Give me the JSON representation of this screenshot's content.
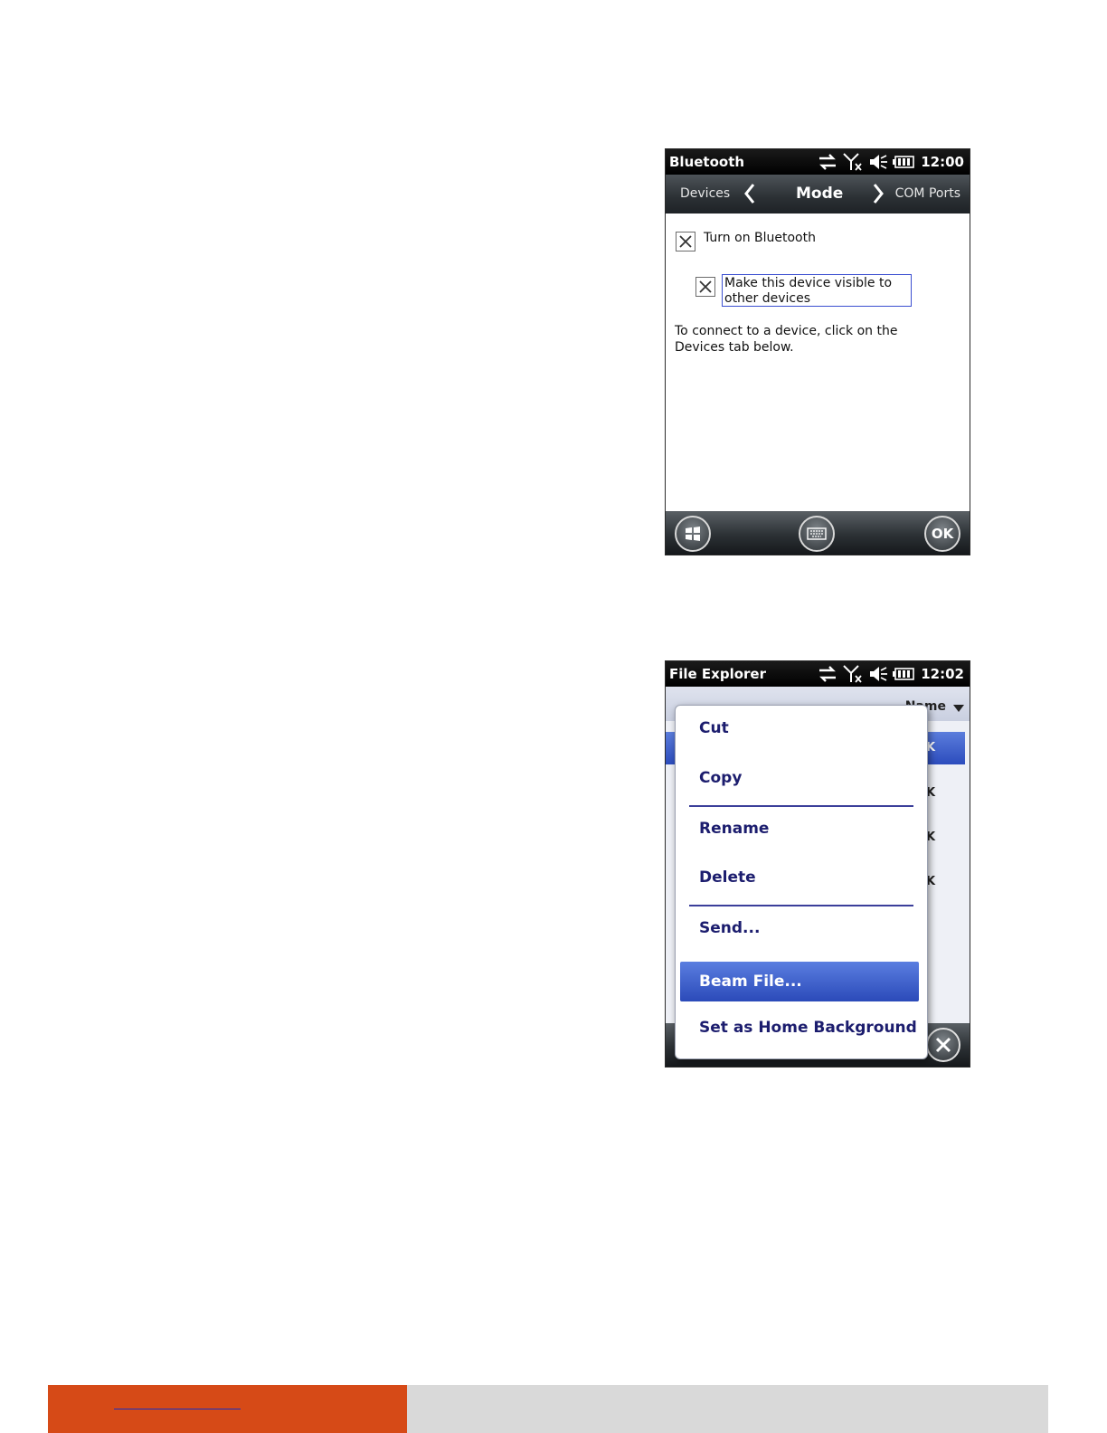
{
  "bluetooth_screen": {
    "status": {
      "title": "Bluetooth",
      "time": "12:00"
    },
    "tabs": {
      "left": "Devices",
      "center": "Mode",
      "right": "COM Ports"
    },
    "turn_on_label": "Turn on Bluetooth",
    "visible_label": "Make this device visible to other devices",
    "info": "To connect to a device, click on the Devices tab below.",
    "softkeys": {
      "ok": "OK"
    }
  },
  "file_explorer_screen": {
    "status": {
      "title": "File Explorer",
      "time": "12:02"
    },
    "sort_label": "Name",
    "size_suffix": "K",
    "context_menu": [
      {
        "label": "Cut",
        "highlighted": false
      },
      {
        "label": "Copy",
        "highlighted": false
      },
      {
        "label": "Rename",
        "highlighted": false
      },
      {
        "label": "Delete",
        "highlighted": false
      },
      {
        "label": "Send...",
        "highlighted": false
      },
      {
        "label": "Beam File...",
        "highlighted": true
      },
      {
        "label": "Set as Home Background",
        "highlighted": false
      }
    ]
  },
  "footer": {
    "accent_color": "#d64a17",
    "bar_color": "#d9d9d9"
  }
}
